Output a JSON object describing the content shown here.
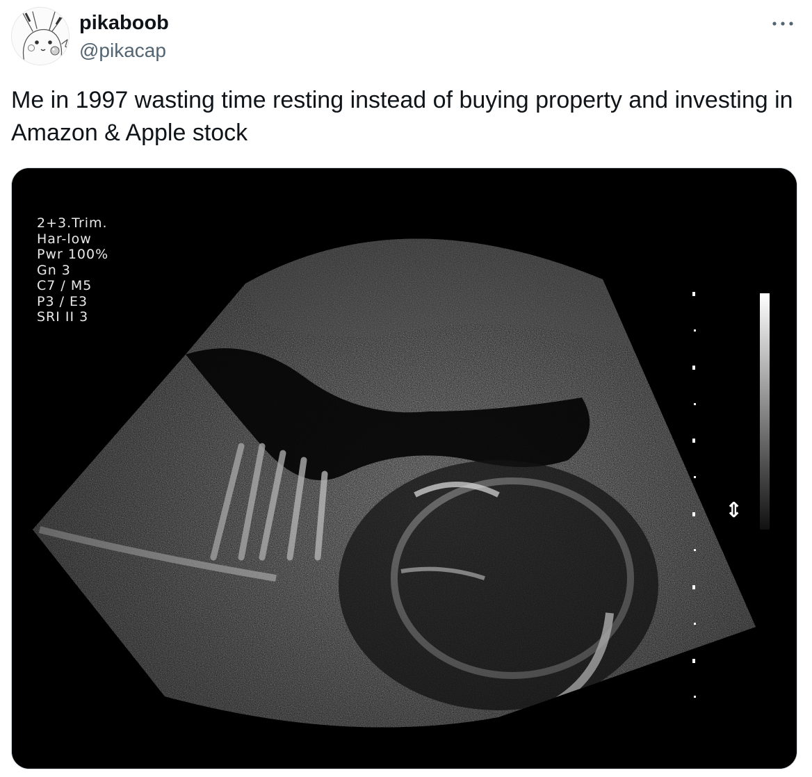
{
  "author": {
    "display_name": "pikaboob",
    "handle": "@pikacap",
    "avatar_icon": "pikachu-sketch-avatar"
  },
  "tweet": {
    "text": "Me in 1997 wasting time resting instead of buying property and investing in Amazon & Apple stock"
  },
  "menu": {
    "icon": "more-horizontal-icon"
  },
  "media": {
    "type": "ultrasound-image",
    "scan_parameters": [
      "2+3.Trim.",
      "Har-low",
      "Pwr 100%",
      "Gn 3",
      "C7 / M5",
      "P3 / E3",
      "SRI II 3"
    ],
    "focus_icon": "⇕"
  },
  "colors": {
    "text_primary": "#0f1419",
    "text_secondary": "#536471",
    "border": "#cfd9de",
    "media_background": "#000000"
  }
}
